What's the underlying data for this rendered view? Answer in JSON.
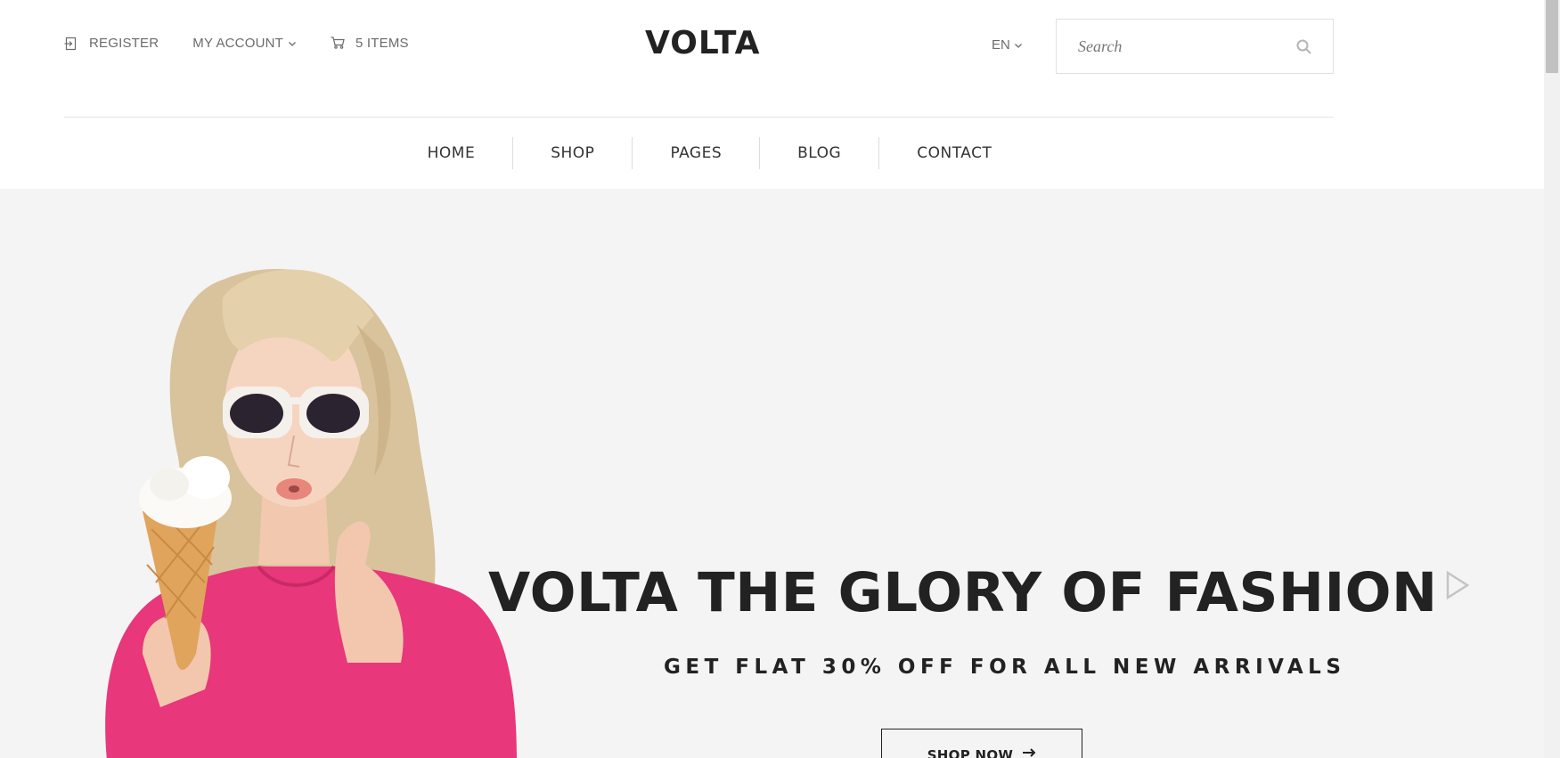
{
  "header": {
    "register_label": "REGISTER",
    "account_label": "MY ACCOUNT",
    "cart_label": "5 ITEMS",
    "logo": "VOLTA",
    "language": "EN",
    "search": {
      "placeholder": "Search",
      "value": ""
    },
    "icons": {
      "register": "sign-in-icon",
      "account_dropdown": "chevron-down-icon",
      "cart": "cart-icon",
      "language_dropdown": "chevron-down-icon",
      "search": "search-icon"
    }
  },
  "nav": {
    "items": [
      {
        "label": "HOME"
      },
      {
        "label": "SHOP"
      },
      {
        "label": "PAGES"
      },
      {
        "label": "BLOG"
      },
      {
        "label": "CONTACT"
      }
    ]
  },
  "hero": {
    "title": "VOLTA THE GLORY OF FASHION",
    "subtitle": "GET FLAT 30% OFF FOR ALL NEW ARRIVALS",
    "cta_label": "SHOP NOW",
    "next_icon": "play-arrow-icon",
    "cta_icon": "arrow-right-icon"
  },
  "colors": {
    "text_dark": "#222222",
    "text_muted": "#6b6b6b",
    "hero_bg": "#f5f4f4",
    "sweater_pink": "#e8377a",
    "divider": "#e6e6e6"
  }
}
